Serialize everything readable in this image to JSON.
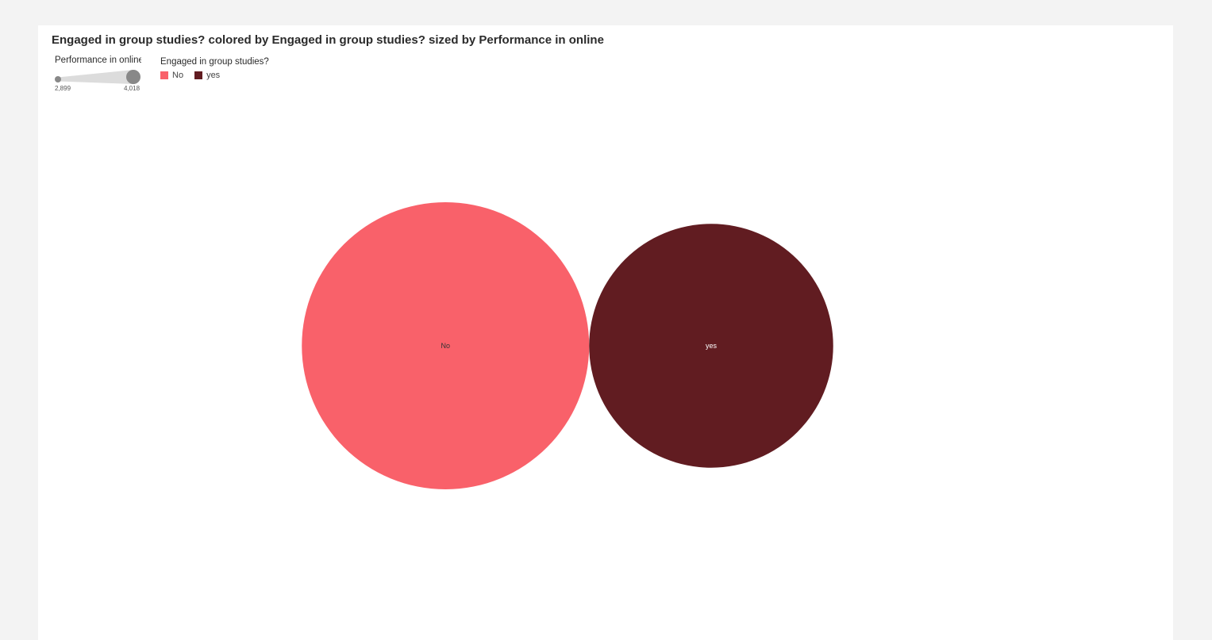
{
  "chart_data": {
    "type": "bubble",
    "title": "Engaged in group studies? colored by Engaged in group studies? sized by Performance in online",
    "categories": [
      "No",
      "yes"
    ],
    "values": [
      4018,
      2899
    ],
    "colors": [
      "#f9616a",
      "#611c21"
    ],
    "label_colors": [
      "#333333",
      "#ffffff"
    ],
    "size_legend": {
      "title": "Performance in online",
      "min_label": "2,899",
      "max_label": "4,018",
      "min": 2899,
      "max": 4018
    },
    "color_legend": {
      "title": "Engaged in group studies?",
      "items": [
        "No",
        "yes"
      ]
    }
  }
}
